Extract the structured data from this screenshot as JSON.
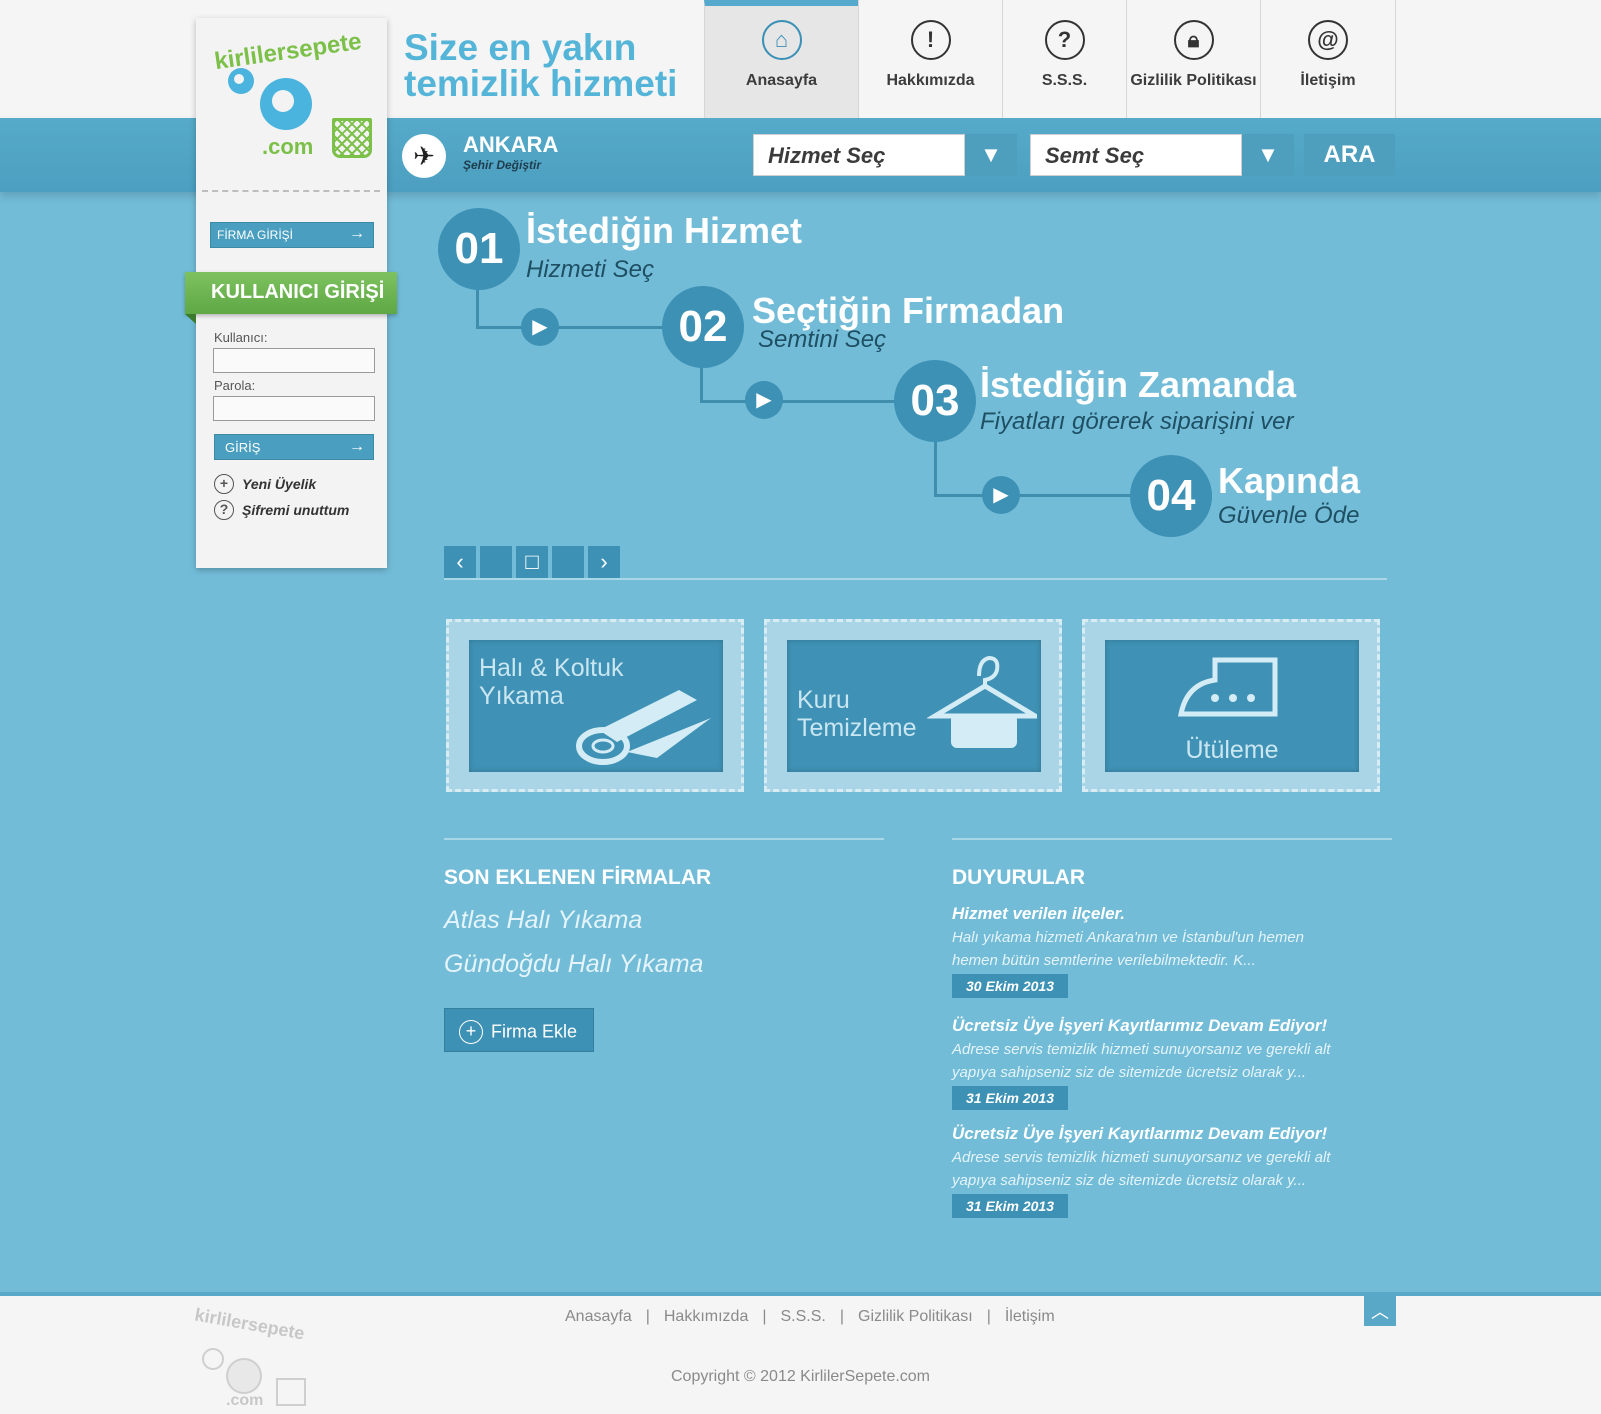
{
  "brand": {
    "logo_text": "kirlilersepete",
    "logo_suffix": ".com",
    "tagline_line1": "Size en yakın",
    "tagline_line2": "temizlik hizmeti",
    "colors": {
      "primary": "#72bcd8",
      "accent": "#3d91b4",
      "green": "#7cc04a"
    }
  },
  "nav": {
    "items": [
      {
        "label": "Anasayfa",
        "icon": "home-icon",
        "active": true
      },
      {
        "label": "Hakkımızda",
        "icon": "info-icon"
      },
      {
        "label": "S.S.S.",
        "icon": "question-icon"
      },
      {
        "label": "Gizlilik Politikası",
        "icon": "lock-icon"
      },
      {
        "label": "İletişim",
        "icon": "at-icon"
      }
    ]
  },
  "city": {
    "name": "ANKARA",
    "change_label": "Şehir Değiştir"
  },
  "search": {
    "service_select": "Hizmet Seç",
    "district_select": "Semt Seç",
    "search_button": "ARA"
  },
  "sidebar": {
    "firma_login": "FİRMA GİRİŞİ",
    "user_login_title": "KULLANICI GİRİŞİ",
    "username_label": "Kullanıcı:",
    "password_label": "Parola:",
    "login_button": "GİRİŞ",
    "new_member": "Yeni Üyelik",
    "forgot_password": "Şifremi unuttum"
  },
  "steps": [
    {
      "num": "01",
      "title": "İstediğin Hizmet",
      "subtitle": "Hizmeti Seç"
    },
    {
      "num": "02",
      "title": "Seçtiğin Firmadan",
      "subtitle": "Semtini Seç"
    },
    {
      "num": "03",
      "title": "İstediğin Zamanda",
      "subtitle": "Fiyatları görerek siparişini ver"
    },
    {
      "num": "04",
      "title": "Kapında",
      "subtitle": "Güvenle Öde"
    }
  ],
  "services": [
    {
      "line1": "Halı & Koltuk",
      "line2": "Yıkama",
      "icon": "rug-icon"
    },
    {
      "line1": "Kuru",
      "line2": "Temizleme",
      "icon": "hanger-icon"
    },
    {
      "line1": "Ütüleme",
      "line2": "",
      "icon": "iron-icon"
    }
  ],
  "recent_firms": {
    "title": "SON EKLENEN FİRMALAR",
    "items": [
      "Atlas Halı Yıkama",
      "Gündoğdu Halı Yıkama"
    ],
    "add_button": "Firma Ekle"
  },
  "announcements": {
    "title": "DUYURULAR",
    "items": [
      {
        "title": "Hizmet verilen ilçeler.",
        "line1": "Halı yıkama hizmeti Ankara'nın ve İstanbul'un hemen",
        "line2": "hemen bütün semtlerine verilebilmektedir. K...",
        "date": "30 Ekim 2013"
      },
      {
        "title": "Ücretsiz Üye İşyeri Kayıtlarımız Devam Ediyor!",
        "line1": "Adrese servis temizlik hizmeti sunuyorsanız ve gerekli alt",
        "line2": "yapıya sahipseniz siz de sitemizde ücretsiz olarak y...",
        "date": "31 Ekim 2013"
      },
      {
        "title": "Ücretsiz Üye İşyeri Kayıtlarımız Devam Ediyor!",
        "line1": "Adrese servis temizlik hizmeti sunuyorsanız ve gerekli alt",
        "line2": "yapıya sahipseniz siz de sitemizde ücretsiz olarak y...",
        "date": "31 Ekim 2013"
      }
    ]
  },
  "footer": {
    "links": [
      "Anasayfa",
      "Hakkımızda",
      "S.S.S.",
      "Gizlilik Politikası",
      "İletişim"
    ],
    "copyright": "Copyright © 2012 KirlilerSepete.com"
  }
}
